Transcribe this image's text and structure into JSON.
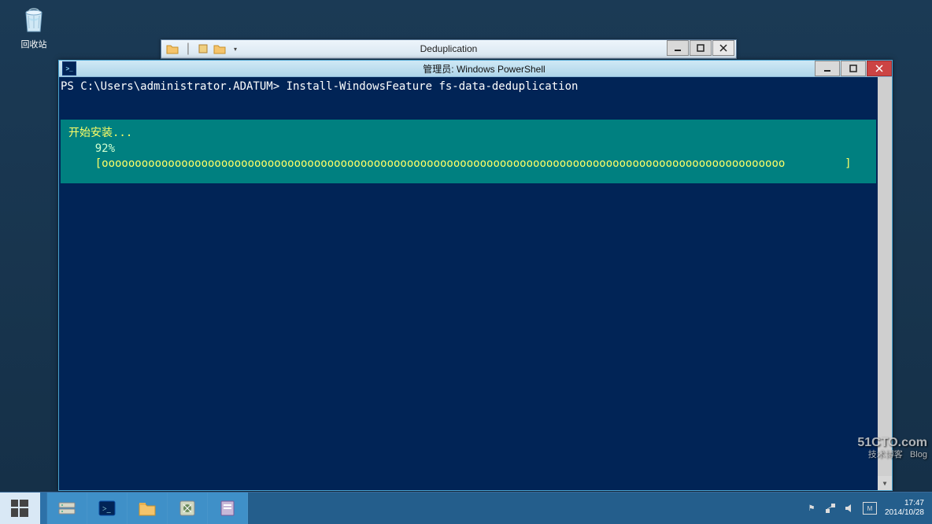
{
  "desktop": {
    "recycle_bin_label": "回收站"
  },
  "explorer": {
    "title": "Deduplication"
  },
  "powershell": {
    "title": "管理员: Windows PowerShell",
    "prompt": "PS C:\\Users\\administrator.ADATUM> ",
    "command": "Install-WindowsFeature fs-data-deduplication",
    "progress_title": "开始安装...",
    "progress_percent": "    92%",
    "progress_bar": "    [ooooooooooooooooooooooooooooooooooooooooooooooooooooooooooooooooooooooooooooooooooooooooooooooooooooooo         ]"
  },
  "taskbar": {
    "items": [
      "start",
      "server-manager",
      "powershell",
      "explorer",
      "security",
      "settings"
    ]
  },
  "systray": {
    "time": "17:47",
    "date": "2014/10/28"
  },
  "watermark": {
    "main": "51CTO.com",
    "sub1": "技术博客",
    "sub2": "Blog"
  }
}
